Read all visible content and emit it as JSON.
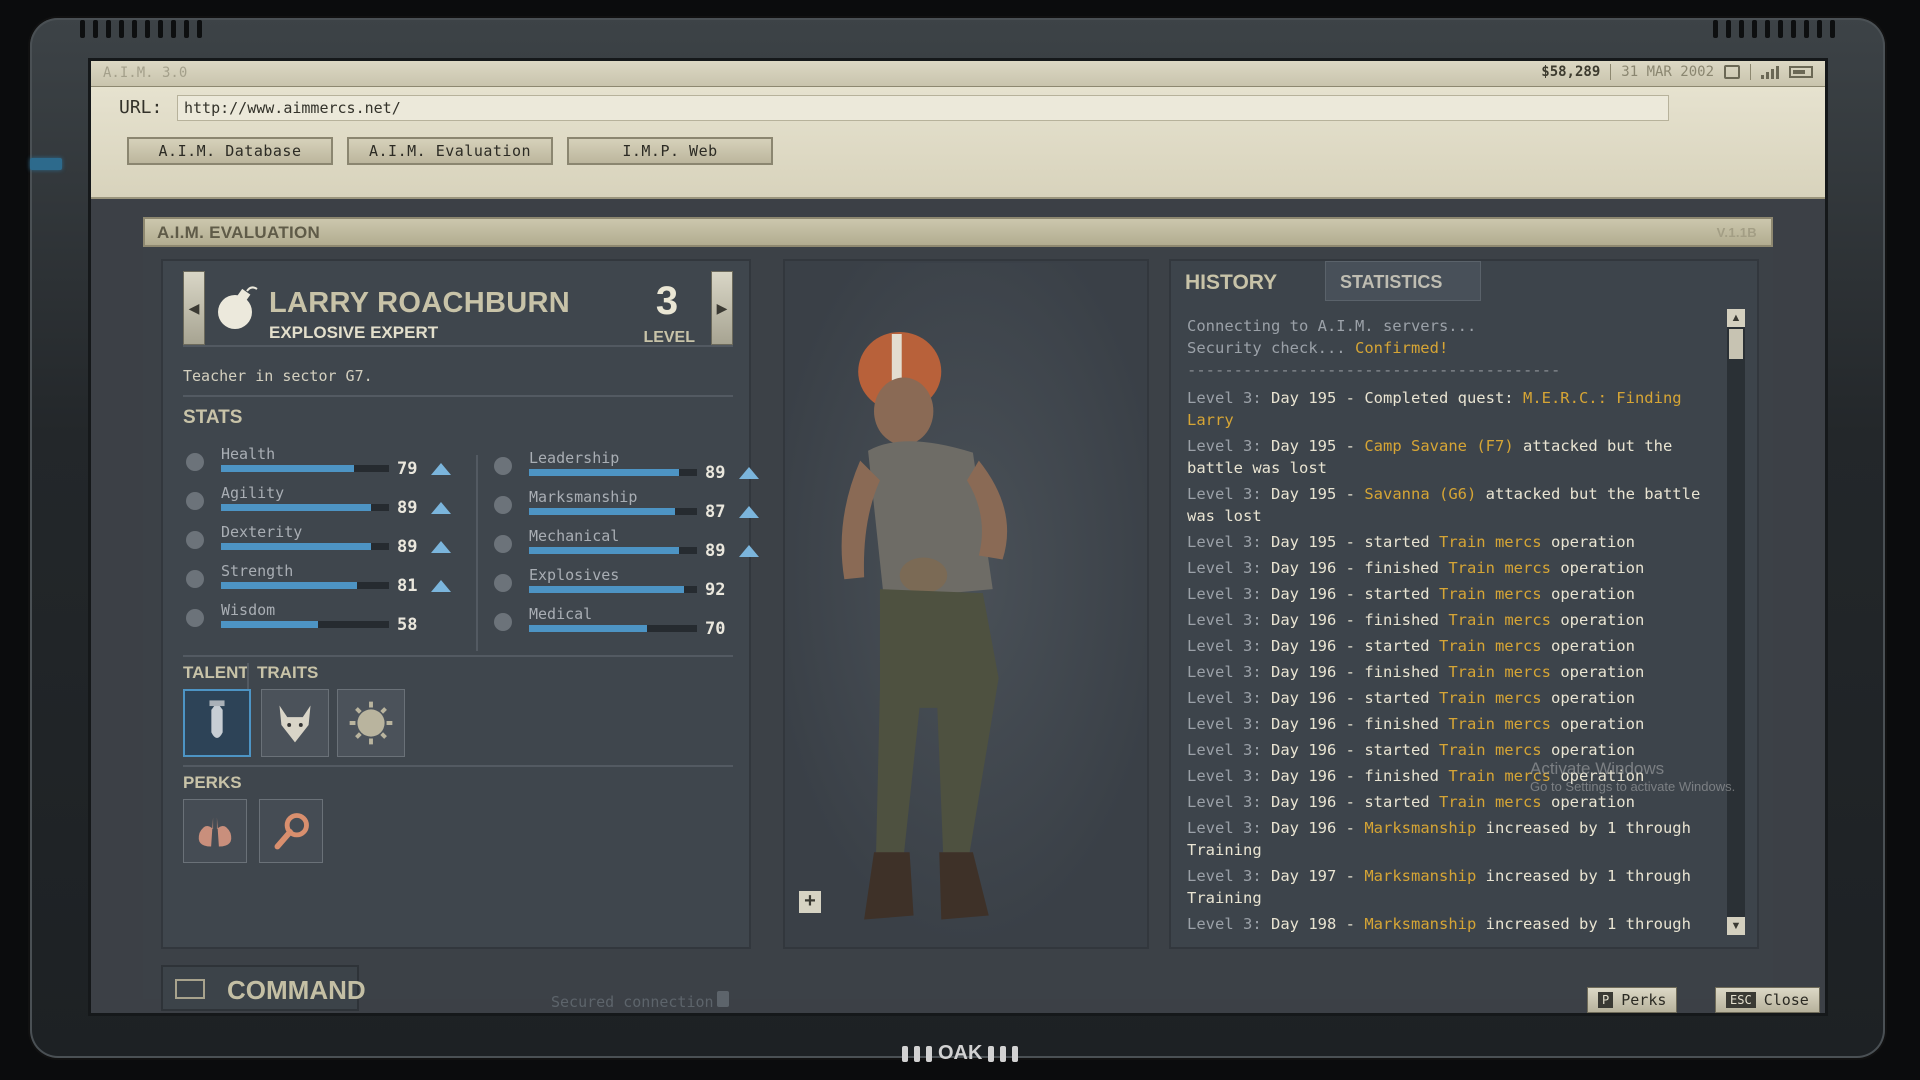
{
  "topbar": {
    "version": "A.I.M. 3.0",
    "money": "$58,289",
    "date": "31 MAR 2002"
  },
  "browser": {
    "url_label": "URL:",
    "url": "http://www.aimmercs.net/",
    "tabs": [
      "A.I.M. Database",
      "A.I.M. Evaluation",
      "I.M.P. Web"
    ]
  },
  "panel": {
    "title": "A.I.M. EVALUATION",
    "version": "V.1.1B"
  },
  "merc": {
    "name": "LARRY ROACHBURN",
    "role": "EXPLOSIVE EXPERT",
    "level": "3",
    "level_label": "LEVEL",
    "bio": "Teacher in sector G7."
  },
  "stats_title": "STATS",
  "stats_left": [
    {
      "label": "Health",
      "value": "79",
      "fill": 0.79,
      "up": true,
      "icon": "heart-icon"
    },
    {
      "label": "Agility",
      "value": "89",
      "fill": 0.89,
      "up": true,
      "icon": "boot-icon"
    },
    {
      "label": "Dexterity",
      "value": "89",
      "fill": 0.89,
      "up": true,
      "icon": "hand-icon"
    },
    {
      "label": "Strength",
      "value": "81",
      "fill": 0.81,
      "up": true,
      "icon": "arm-icon"
    },
    {
      "label": "Wisdom",
      "value": "58",
      "fill": 0.58,
      "up": false,
      "icon": "brain-icon"
    }
  ],
  "stats_right": [
    {
      "label": "Leadership",
      "value": "89",
      "fill": 0.89,
      "up": true,
      "icon": "trophy-icon"
    },
    {
      "label": "Marksmanship",
      "value": "87",
      "fill": 0.87,
      "up": true,
      "icon": "crosshair-icon"
    },
    {
      "label": "Mechanical",
      "value": "89",
      "fill": 0.89,
      "up": true,
      "icon": "wrench-icon"
    },
    {
      "label": "Explosives",
      "value": "92",
      "fill": 0.92,
      "up": false,
      "icon": "grenade-icon"
    },
    {
      "label": "Medical",
      "value": "70",
      "fill": 0.7,
      "up": false,
      "icon": "medkit-icon"
    }
  ],
  "talent_title": "TALENT",
  "traits_title": "TRAITS",
  "perks_title": "PERKS",
  "tabs": {
    "history": "HISTORY",
    "statistics": "STATISTICS"
  },
  "log": {
    "connect": "Connecting to A.I.M. servers...",
    "security": "Security check...",
    "confirmed": "Confirmed!",
    "divider": "----------------------------------------",
    "entries": [
      {
        "pre": "Level 3:",
        "day": "Day 195 - Completed quest:",
        "hl": "M.E.R.C.: Finding Larry",
        "post": ""
      },
      {
        "pre": "Level 3:",
        "day": "Day 195 -",
        "hl": "Camp Savane (F7)",
        "post": "attacked but the battle was lost"
      },
      {
        "pre": "Level 3:",
        "day": "Day 195 -",
        "hl": "Savanna (G6)",
        "post": "attacked but the battle was lost"
      },
      {
        "pre": "Level 3:",
        "day": "Day 195 - started",
        "hl": "Train mercs",
        "post": "operation"
      },
      {
        "pre": "Level 3:",
        "day": "Day 196 - finished",
        "hl": "Train mercs",
        "post": "operation"
      },
      {
        "pre": "Level 3:",
        "day": "Day 196 - started",
        "hl": "Train mercs",
        "post": "operation"
      },
      {
        "pre": "Level 3:",
        "day": "Day 196 - finished",
        "hl": "Train mercs",
        "post": "operation"
      },
      {
        "pre": "Level 3:",
        "day": "Day 196 - started",
        "hl": "Train mercs",
        "post": "operation"
      },
      {
        "pre": "Level 3:",
        "day": "Day 196 - finished",
        "hl": "Train mercs",
        "post": "operation"
      },
      {
        "pre": "Level 3:",
        "day": "Day 196 - started",
        "hl": "Train mercs",
        "post": "operation"
      },
      {
        "pre": "Level 3:",
        "day": "Day 196 - finished",
        "hl": "Train mercs",
        "post": "operation"
      },
      {
        "pre": "Level 3:",
        "day": "Day 196 - started",
        "hl": "Train mercs",
        "post": "operation"
      },
      {
        "pre": "Level 3:",
        "day": "Day 196 - finished",
        "hl": "Train mercs",
        "post": "operation"
      },
      {
        "pre": "Level 3:",
        "day": "Day 196 - started",
        "hl": "Train mercs",
        "post": "operation"
      },
      {
        "pre": "Level 3:",
        "day": "Day 196 -",
        "hl": "Marksmanship",
        "post": "increased by 1 through Training"
      },
      {
        "pre": "Level 3:",
        "day": "Day 197 -",
        "hl": "Marksmanship",
        "post": "increased by 1 through Training"
      },
      {
        "pre": "Level 3:",
        "day": "Day 198 -",
        "hl": "Marksmanship",
        "post": "increased by 1 through"
      }
    ]
  },
  "footer": {
    "command": "COMMAND",
    "secured": "Secured connection",
    "perks_key": "P",
    "perks_label": "Perks",
    "close_key": "ESC",
    "close_label": "Close",
    "activate_1": "Activate Windows",
    "activate_2": "Go to Settings to activate Windows.",
    "brand": "OAK"
  },
  "colors": {
    "accent": "#4d94c4",
    "highlight": "#d6a535",
    "panel": "#3f464d"
  }
}
